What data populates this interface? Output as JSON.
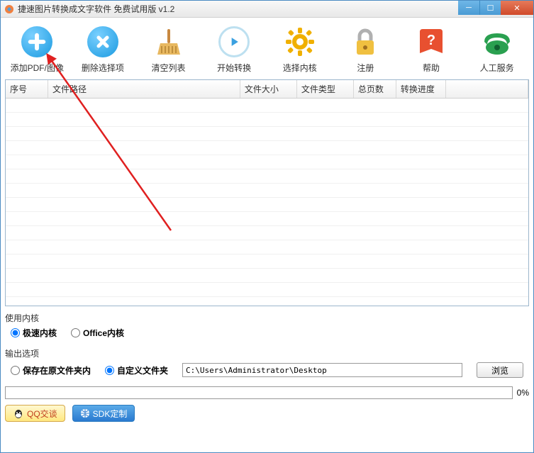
{
  "window": {
    "title": "捷速图片转换成文字软件 免费试用版 v1.2"
  },
  "toolbar": {
    "add": "添加PDF/图像",
    "delete": "删除选择项",
    "clear": "清空列表",
    "start": "开始转换",
    "engine": "选择内核",
    "register": "注册",
    "help": "帮助",
    "service": "人工服务"
  },
  "table": {
    "headers": {
      "seq": "序号",
      "path": "文件路径",
      "size": "文件大小",
      "type": "文件类型",
      "pages": "总页数",
      "progress": "转换进度"
    }
  },
  "engine_section": {
    "label": "使用内核",
    "fast": "极速内核",
    "office": "Office内核"
  },
  "output_section": {
    "label": "输出选项",
    "same_folder": "保存在原文件夹内",
    "custom_folder": "自定义文件夹",
    "path_value": "C:\\Users\\Administrator\\Desktop",
    "browse": "浏览"
  },
  "progress": {
    "percent": "0%"
  },
  "bottom": {
    "qq": "QQ交谈",
    "sdk": "SDK定制"
  }
}
